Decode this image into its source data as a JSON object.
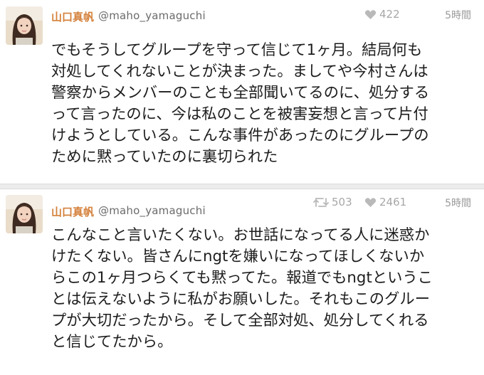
{
  "tweets": [
    {
      "display_name": "山口真帆",
      "handle": "@maho_yamaguchi",
      "likes": "422",
      "time": "5時間",
      "lines": [
        "でもそうしてグループを守って信じて1ヶ月。結局何も",
        "対処してくれないことが決まった。ましてや今村さんは",
        "警察からメンバーのことも全部聞いてるのに、処分する",
        "って言ったのに、今は私のことを被害妄想と言って片付",
        "けようとしている。こんな事件があったのにグループの",
        "ために黙っていたのに裏切られた"
      ]
    },
    {
      "display_name": "山口真帆",
      "handle": "@maho_yamaguchi",
      "retweets": "503",
      "likes": "2461",
      "time": "5時間",
      "lines": [
        "こんなこと言いたくない。お世話になってる人に迷惑か",
        "けたくない。皆さんにngtを嫌いになってほしくないか",
        "らこの1ヶ月つらくても黙ってた。報道でもngtというこ",
        "とは伝えないように私がお願いした。それもこのグルー",
        "プが大切だったから。そして全部対処、処分してくれる",
        "と信じてたから。"
      ]
    }
  ],
  "icons": {
    "like": "heart-icon",
    "retweet": "retweet-icon"
  },
  "colors": {
    "display_name": "#d4813b",
    "handle": "#6b6b6b",
    "meta": "#a7a7a7",
    "text": "#1d1d1d",
    "separator": "#ececec"
  }
}
